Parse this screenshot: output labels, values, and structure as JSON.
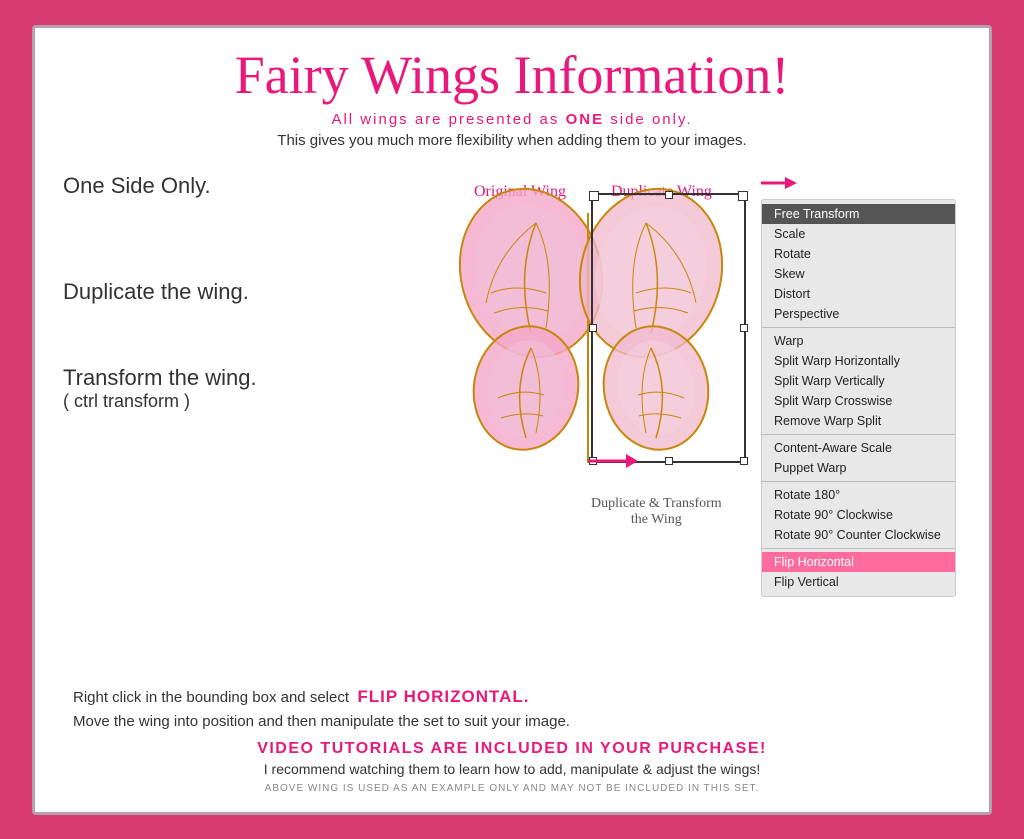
{
  "page": {
    "title": "Fairy Wings Information!",
    "subtitle": "All wings are presented as ONE side only.",
    "description": "This gives you much more flexibility when adding them to your images.",
    "labels": {
      "one_side": "One Side Only.",
      "duplicate": "Duplicate the wing.",
      "transform": "Transform the wing.",
      "transform_sub": "( ctrl transform )",
      "original_wing": "Original Wing",
      "duplicate_wing": "Duplicate Wing",
      "dup_transform": "Duplicate & Transform the Wing"
    },
    "flip_horizontal_text": "Right click in the bounding box and select",
    "flip_horizontal_label": "FLIP HORIZONTAL.",
    "move_text": "Move the wing into position and then manipulate the set to suit your image.",
    "video_title": "VIDEO TUTORIALS ARE INCLUDED IN YOUR PURCHASE!",
    "video_sub": "I recommend watching them to learn how to add, manipulate & adjust the wings!",
    "footnote": "ABOVE WING IS USED AS AN EXAMPLE ONLY AND MAY NOT BE INCLUDED IN THIS SET."
  },
  "context_menu": {
    "items": [
      {
        "label": "Free Transform",
        "type": "active"
      },
      {
        "label": "Scale",
        "type": "normal"
      },
      {
        "label": "Rotate",
        "type": "normal"
      },
      {
        "label": "Skew",
        "type": "normal"
      },
      {
        "label": "Distort",
        "type": "normal"
      },
      {
        "label": "Perspective",
        "type": "normal"
      },
      {
        "label": "divider"
      },
      {
        "label": "Warp",
        "type": "normal"
      },
      {
        "label": "Split Warp Horizontally",
        "type": "normal"
      },
      {
        "label": "Split Warp Vertically",
        "type": "normal"
      },
      {
        "label": "Split Warp Crosswise",
        "type": "normal"
      },
      {
        "label": "Remove Warp Split",
        "type": "normal"
      },
      {
        "label": "divider"
      },
      {
        "label": "Content-Aware Scale",
        "type": "normal"
      },
      {
        "label": "Puppet Warp",
        "type": "normal"
      },
      {
        "label": "divider"
      },
      {
        "label": "Rotate 180°",
        "type": "normal"
      },
      {
        "label": "Rotate 90° Clockwise",
        "type": "normal"
      },
      {
        "label": "Rotate 90° Counter Clockwise",
        "type": "normal"
      },
      {
        "label": "divider"
      },
      {
        "label": "Flip Horizontal",
        "type": "highlighted"
      },
      {
        "label": "Flip Vertical",
        "type": "normal"
      }
    ]
  }
}
